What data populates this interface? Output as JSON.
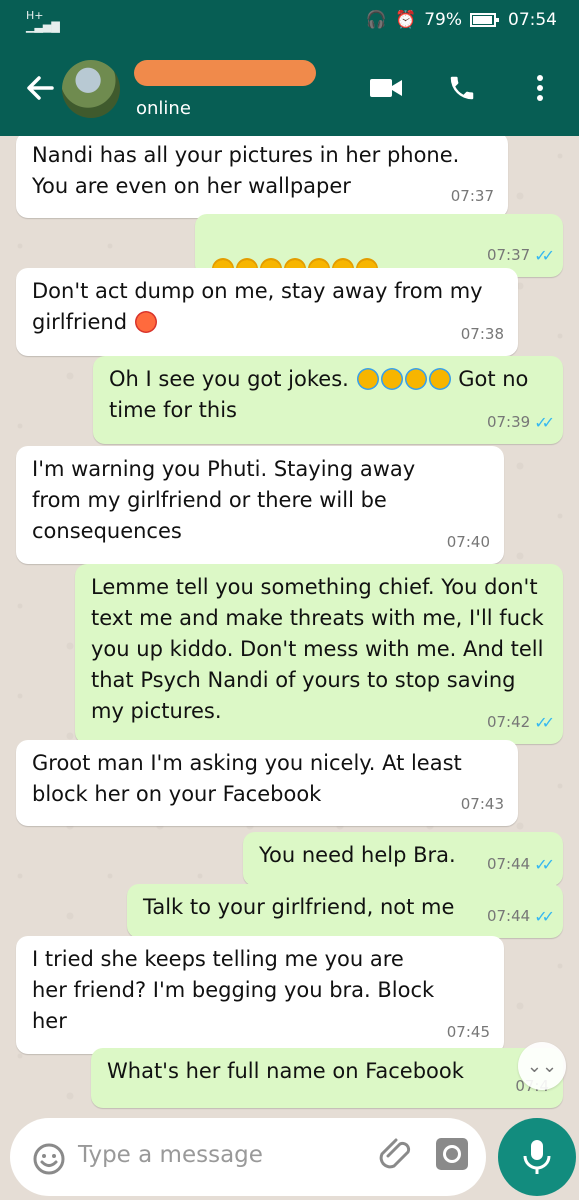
{
  "status": {
    "battery": "79%",
    "time": "07:54",
    "network": "H+"
  },
  "contact": {
    "status": "online"
  },
  "colors": {
    "header": "#075e54",
    "outgoing": "#dcf8c6",
    "incoming": "#ffffff",
    "mic": "#128c7e"
  },
  "messages": [
    {
      "text": "Nandi has all your pictures in her phone.\nYou are even on her wallpaper",
      "time": "07:37",
      "dir": "in"
    },
    {
      "text": "",
      "time": "07:37",
      "dir": "out",
      "emoji": "flushed-face-emoji x7"
    },
    {
      "text": "Don't act dump on me, stay away from my\ngirlfriend",
      "time": "07:38",
      "dir": "in",
      "emoji": "angry-face-emoji"
    },
    {
      "text": "Oh I see you got jokes.",
      "text2": "Got no\ntime for this",
      "time": "07:39",
      "dir": "out",
      "emoji": "tears-of-joy-emoji x4"
    },
    {
      "text": "I'm warning you Phuti. Staying away\nfrom my girlfriend or there will be\nconsequences",
      "time": "07:40",
      "dir": "in"
    },
    {
      "text": "Lemme tell you something chief. You don't\ntext me and make threats with me, I'll fuck\nyou up kiddo. Don't mess with me. And tell\nthat Psych Nandi of yours to stop saving\nmy pictures.",
      "time": "07:42",
      "dir": "out"
    },
    {
      "text": "Groot man I'm asking you nicely. At least\nblock her on your Facebook",
      "time": "07:43",
      "dir": "in"
    },
    {
      "text": "You need help Bra.",
      "time": "07:44",
      "dir": "out"
    },
    {
      "text": "Talk to your girlfriend, not me",
      "time": "07:44",
      "dir": "out"
    },
    {
      "text": "I tried she keeps telling me you are\nher friend? I'm begging you bra. Block\nher",
      "time": "07:45",
      "dir": "in"
    },
    {
      "text": "What's her full name on Facebook",
      "time": "07:4",
      "dir": "out"
    }
  ],
  "input": {
    "placeholder": "Type a message"
  }
}
